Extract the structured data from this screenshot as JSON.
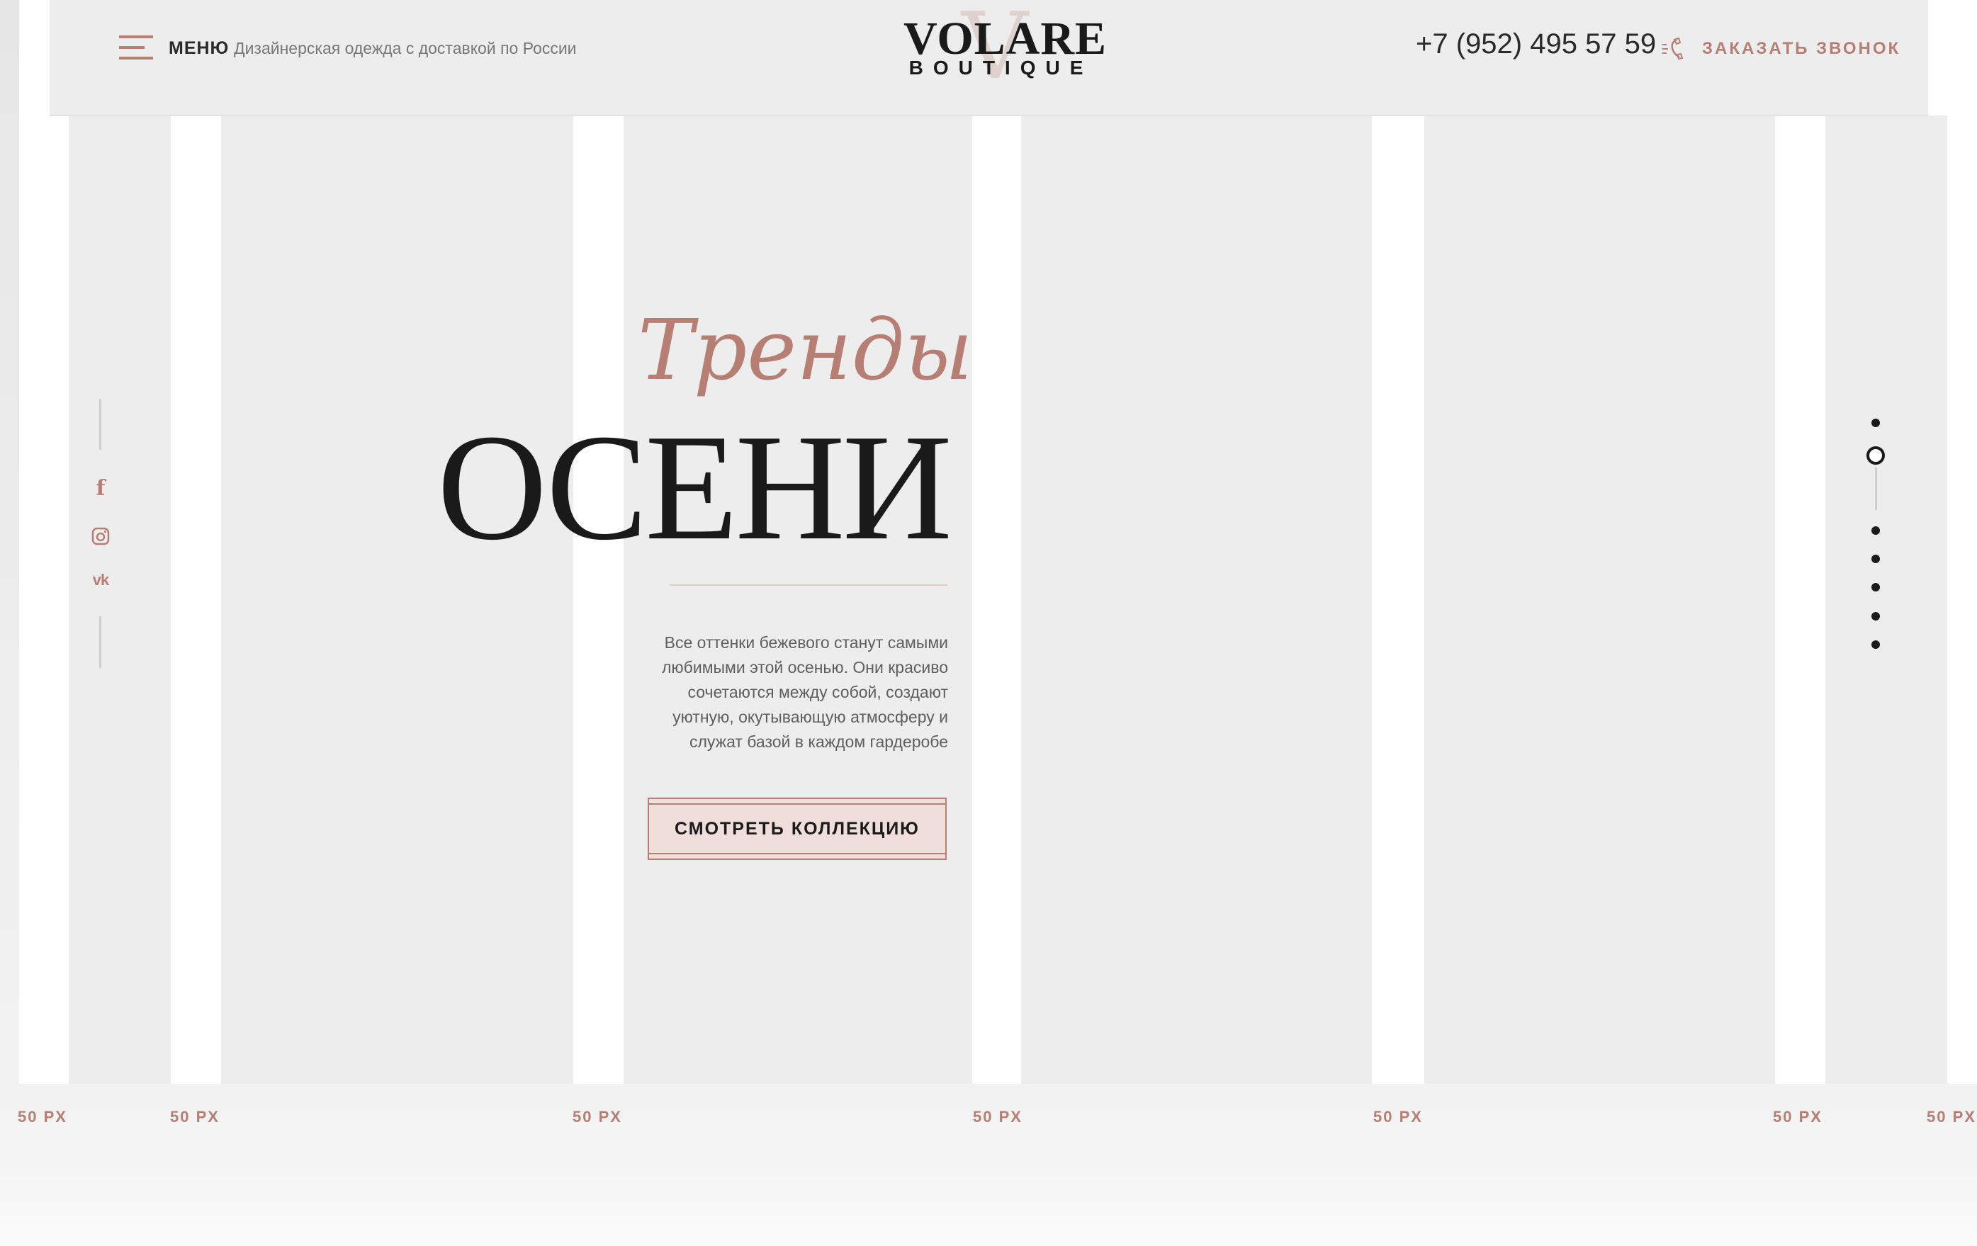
{
  "header": {
    "menu_label": "МЕНЮ",
    "tagline": "Дизайнерская одежда с доставкой по России",
    "logo_word": "VOLARE",
    "logo_sub": "BOUTIQUE",
    "logo_mark": "V",
    "phone": "+7 (952) 495 57 59",
    "callback_label": "ЗАКАЗАТЬ ЗВОНОК"
  },
  "social": {
    "facebook": "f",
    "vk": "vk"
  },
  "hero": {
    "trend_word": "Тренды",
    "title": "ОСЕНИ",
    "description": "Все оттенки бежевого станут самыми\nлюбимыми этой осенью. Они красиво\nсочетаются между собой, создают\nуютную, окутывающую атмосферу и\nслужат базой в каждом гардеробе",
    "cta_label": "СМОТРЕТЬ КОЛЛЕКЦИЮ"
  },
  "slider": {
    "total": 7,
    "active_index": 1
  },
  "grid_labels": [
    "50 PX",
    "50 PX",
    "50 PX",
    "50 PX",
    "50 PX",
    "50 PX",
    "50 PX"
  ],
  "colors": {
    "accent": "#b77f73",
    "background": "#ededed",
    "gutter": "#ffffff",
    "text": "#1a1a1a"
  },
  "icons": [
    "hamburger-icon",
    "phone-icon",
    "facebook-icon",
    "instagram-icon",
    "vk-icon"
  ]
}
